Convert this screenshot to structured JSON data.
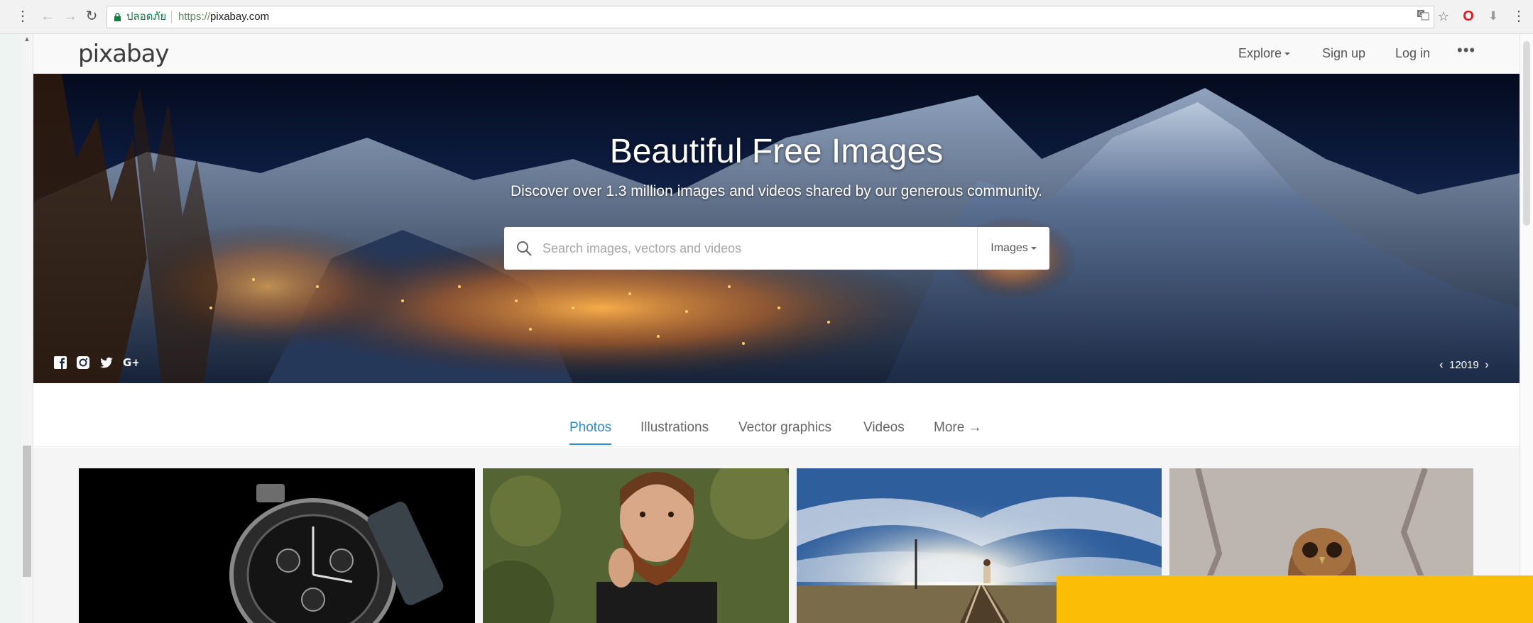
{
  "browser": {
    "secure_label": "ปลอดภัย",
    "url_scheme": "https://",
    "url_host": "pixabay.com",
    "icons": [
      "menu-dots-icon",
      "back-icon",
      "forward-icon",
      "reload-icon",
      "lock-icon",
      "translate-icon",
      "star-icon",
      "opera-icon",
      "download-icon",
      "kebab-icon"
    ]
  },
  "header": {
    "logo": "pixabay",
    "nav": {
      "explore": "Explore",
      "signup": "Sign up",
      "login": "Log in",
      "more": "•••"
    }
  },
  "hero": {
    "title": "Beautiful Free Images",
    "subtitle": "Discover over 1.3 million images and videos shared by our generous community.",
    "search": {
      "placeholder": "Search images, vectors and videos",
      "type_selected": "Images"
    },
    "social": [
      "facebook-icon",
      "instagram-icon",
      "twitter-icon",
      "google-plus-icon"
    ],
    "credit_user": "12019",
    "credit_prev": "‹",
    "credit_next": "›"
  },
  "tabs": [
    {
      "label": "Photos",
      "active": true
    },
    {
      "label": "Illustrations",
      "active": false
    },
    {
      "label": "Vector graphics",
      "active": false
    },
    {
      "label": "Videos",
      "active": false
    },
    {
      "label": "More →",
      "active": false
    }
  ],
  "gallery": [
    "watch",
    "bearded-man",
    "railway-track",
    "owl"
  ],
  "colors": {
    "accent": "#2a8bcd",
    "promo": "#fbbd05",
    "secure": "#0b8043"
  }
}
